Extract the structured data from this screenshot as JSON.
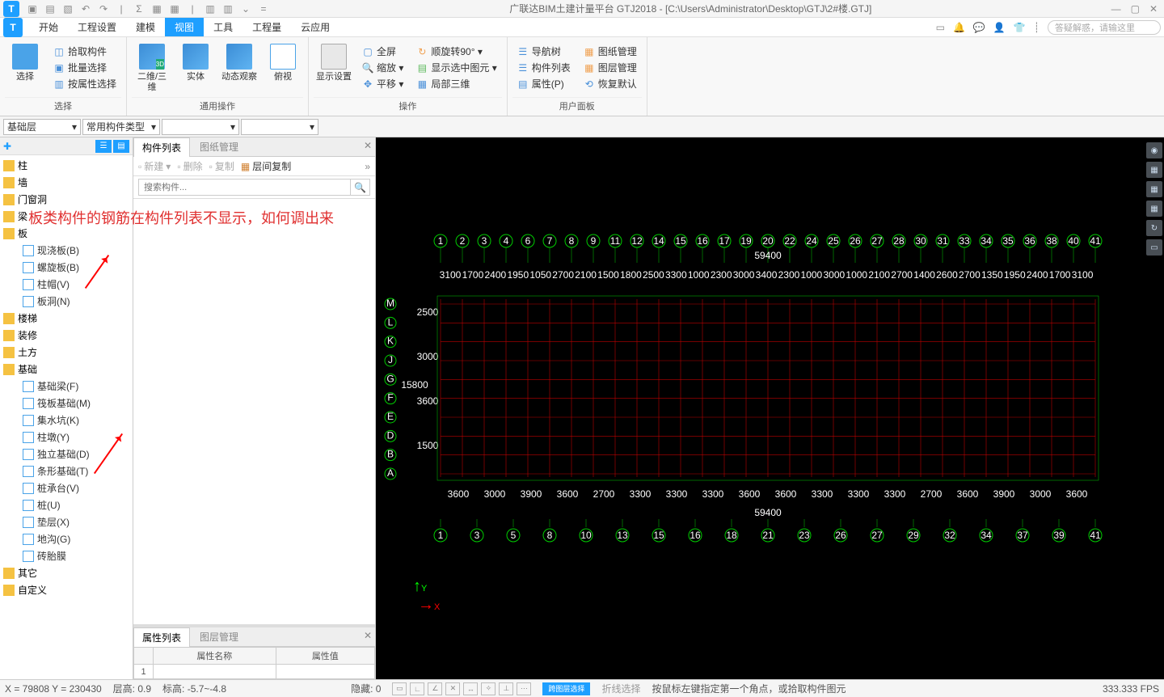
{
  "app": {
    "title": "广联达BIM土建计量平台 GTJ2018 - [C:\\Users\\Administrator\\Desktop\\GTJ\\2#楼.GTJ]",
    "logo": "T"
  },
  "menu": {
    "items": [
      "开始",
      "工程设置",
      "建模",
      "视图",
      "工具",
      "工程量",
      "云应用"
    ],
    "active": 3,
    "search_placeholder": "答疑解惑，请输这里"
  },
  "ribbon": {
    "groups": [
      {
        "label": "选择",
        "big": [
          {
            "label": "选择"
          }
        ],
        "small": [
          "拾取构件",
          "批量选择",
          "按属性选择"
        ]
      },
      {
        "label": "通用操作",
        "big": [
          {
            "label": "二维/三维"
          },
          {
            "label": "实体"
          },
          {
            "label": "动态观察"
          },
          {
            "label": "俯视"
          }
        ],
        "small": []
      },
      {
        "label": "操作",
        "big": [
          {
            "label": "显示设置"
          }
        ],
        "small": [
          "全屏",
          "缩放 ▾",
          "平移 ▾",
          "顺旋转90° ▾",
          "显示选中图元 ▾",
          "局部三维"
        ]
      },
      {
        "label": "用户面板",
        "big": [],
        "small": [
          "导航树",
          "构件列表",
          "属性(P)",
          "图纸管理",
          "图层管理",
          "恢复默认"
        ]
      }
    ]
  },
  "dropdowns": {
    "d1": "基础层",
    "d2": "常用构件类型",
    "d3": "",
    "d4": ""
  },
  "leftnav": {
    "groups": [
      {
        "name": "柱"
      },
      {
        "name": "墙"
      },
      {
        "name": "门窗洞"
      },
      {
        "name": "梁"
      },
      {
        "name": "板",
        "children": [
          "现浇板(B)",
          "螺旋板(B)",
          "柱帽(V)",
          "板洞(N)"
        ]
      },
      {
        "name": "楼梯"
      },
      {
        "name": "装修"
      },
      {
        "name": "土方"
      },
      {
        "name": "基础",
        "children": [
          "基础梁(F)",
          "筏板基础(M)",
          "集水坑(K)",
          "柱墩(Y)",
          "独立基础(D)",
          "条形基础(T)",
          "桩承台(V)",
          "桩(U)",
          "垫层(X)",
          "地沟(G)",
          "砖胎膜"
        ]
      },
      {
        "name": "其它"
      },
      {
        "name": "自定义"
      }
    ]
  },
  "midpanel": {
    "tabs": {
      "a": "构件列表",
      "b": "图纸管理"
    },
    "toolbar": {
      "new": "新建",
      "del": "删除",
      "copy": "复制",
      "layercopy": "层间复制"
    },
    "search_placeholder": "搜索构件...",
    "overlay": "板类构件的钢筋在构件列表不显示，如何调出来"
  },
  "propspanel": {
    "tabs": {
      "a": "属性列表",
      "b": "图层管理"
    },
    "cols": {
      "name": "属性名称",
      "val": "属性值"
    },
    "rowidx": "1"
  },
  "viewport": {
    "top_total": "59400",
    "bottom_total": "59400",
    "top_axes": [
      "1",
      "2",
      "3",
      "4",
      "6",
      "7",
      "8",
      "9",
      "11",
      "12",
      "14",
      "15",
      "16",
      "17",
      "19",
      "20",
      "22",
      "24",
      "25",
      "26",
      "27",
      "28",
      "30",
      "31",
      "33",
      "34",
      "35",
      "36",
      "38",
      "40",
      "41"
    ],
    "bottom_axes": [
      "1",
      "3",
      "5",
      "8",
      "10",
      "13",
      "15",
      "16",
      "18",
      "21",
      "23",
      "26",
      "27",
      "29",
      "32",
      "34",
      "37",
      "39",
      "41"
    ],
    "left_axes": [
      "M",
      "L",
      "K",
      "J",
      "G",
      "F",
      "E",
      "D",
      "B",
      "A"
    ],
    "v_total": "15800",
    "v_dims": [
      "2500",
      "3000",
      "3600",
      "1500"
    ],
    "top_dims": [
      "3100",
      "1700",
      "2400",
      "1950",
      "1050",
      "2700",
      "2100",
      "1500",
      "1800",
      "2500",
      "3300",
      "1000",
      "2300",
      "3000",
      "3400",
      "2300",
      "1000",
      "3000",
      "1000",
      "2100",
      "2700",
      "1400",
      "2600",
      "2700",
      "1350",
      "1950",
      "2400",
      "1700",
      "3100"
    ],
    "bottom_dims": [
      "3600",
      "3000",
      "3900",
      "3600",
      "2700",
      "3300",
      "3300",
      "3300",
      "3600",
      "3600",
      "3300",
      "3300",
      "3300",
      "2700",
      "3600",
      "3900",
      "3000",
      "3600"
    ]
  },
  "statusbar": {
    "coords": "X = 79808 Y = 230430",
    "floorh": "层高:    0.9",
    "elev": "标高:   -5.7~-4.8",
    "hide": "隐藏: 0",
    "cross": "跨图层选择",
    "polyline": "折线选择",
    "hint": "按鼠标左键指定第一个角点，或拾取构件图元",
    "fps": "333.333 FPS"
  }
}
